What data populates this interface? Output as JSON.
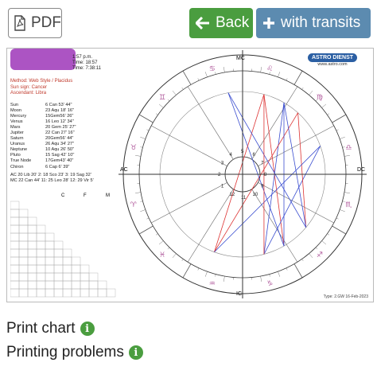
{
  "toolbar": {
    "pdf_label": "PDF",
    "back_label": "Back",
    "transits_label": "with transits"
  },
  "chart_sheet": {
    "meta_lines": [
      "1:57 p.m.",
      "Time: 18:57",
      "Time:     7:38:11"
    ],
    "method": "Method: Web Style / Placidus",
    "sun_sign": "Sun sign: Cancer",
    "ascendant": "Ascendant: Libra",
    "planets": [
      {
        "name": "Sun",
        "pos": "6 Can 53' 44\""
      },
      {
        "name": "Moon",
        "pos": "23 Aqu 18' 16\""
      },
      {
        "name": "Mercury",
        "pos": "15Gem56' 26\""
      },
      {
        "name": "Venus",
        "pos": "16 Leo 12' 34\""
      },
      {
        "name": "Mars",
        "pos": "20 Gem 25' 27\""
      },
      {
        "name": "Jupiter",
        "pos": "22 Can 27' 16\""
      },
      {
        "name": "Saturn",
        "pos": "20Gem56' 44\""
      },
      {
        "name": "Uranus",
        "pos": "26 Aqu 34' 27\""
      },
      {
        "name": "Neptune",
        "pos": "10 Aqu 26' 50\""
      },
      {
        "name": "Pluto",
        "pos": "15 Sag 42' 10\""
      },
      {
        "name": "True Node",
        "pos": "17Gem43' 40\""
      },
      {
        "name": "Chiron",
        "pos": "6 Cap  6' 39\""
      }
    ],
    "houses_line1": "AC 20 Lib 20'   2: 18 Sco 23'   3: 19 Sag 32'",
    "houses_line2": "MC 22 Can 44'  11: 25 Leo 28'  12: 29 Vir  5'",
    "grid_header": [
      "C",
      "F",
      "M"
    ],
    "logo_text": "ASTRO DIENST",
    "logo_url": "www.astro.com",
    "type_text": "Type: 2.GW   16-Feb-2023",
    "axis_labels": {
      "mc": "MC",
      "ic": "IC",
      "ac": "AC",
      "dc": "DC",
      "deg": "22",
      "deg_ac": "20"
    },
    "house_numbers": [
      "1",
      "2",
      "3",
      "4",
      "5",
      "6",
      "7",
      "8",
      "9",
      "10",
      "11",
      "12"
    ]
  },
  "footer": {
    "print_chart": "Print chart",
    "printing_problems": "Printing problems"
  },
  "colors": {
    "green": "#4a9d3f",
    "blue": "#5c8bb0",
    "aspect_red": "#d33",
    "aspect_blue": "#3b4ed0",
    "aspect_green": "#3a3"
  }
}
